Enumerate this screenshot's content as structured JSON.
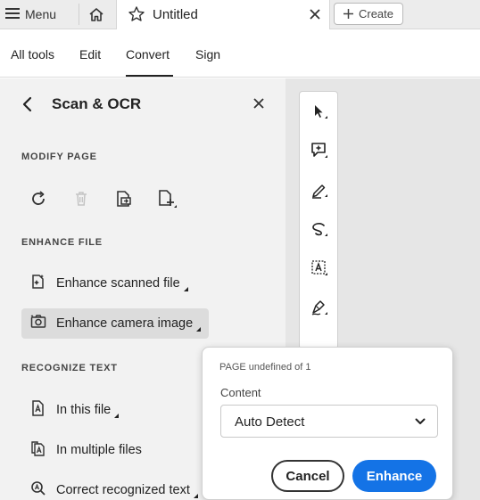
{
  "tabbar": {
    "menu_label": "Menu",
    "tab_title": "Untitled",
    "create_label": "Create"
  },
  "nav": {
    "items": [
      "All tools",
      "Edit",
      "Convert",
      "Sign"
    ],
    "active": "Convert"
  },
  "panel": {
    "title": "Scan & OCR",
    "modify_label": "MODIFY PAGE",
    "modify_tools": [
      "rotate-icon",
      "delete-icon",
      "extract-page-icon",
      "insert-page-icon"
    ],
    "enhance_label": "ENHANCE FILE",
    "enhance_items": [
      "Enhance scanned file",
      "Enhance camera image"
    ],
    "recognize_label": "RECOGNIZE TEXT",
    "recognize_items": [
      "In this file",
      "In multiple files",
      "Correct recognized text"
    ]
  },
  "toolrail": {
    "icons": [
      "select-arrow-icon",
      "add-comment-icon",
      "highlight-pen-icon",
      "freehand-draw-icon",
      "text-recognition-icon",
      "sign-icon"
    ]
  },
  "popover": {
    "page_text": "PAGE undefined of 1",
    "content_label": "Content",
    "content_value": "Auto Detect",
    "cancel_label": "Cancel",
    "enhance_label": "Enhance"
  },
  "colors": {
    "accent": "#1473e6",
    "panel_bg": "#f2f2f2",
    "doc_bg": "#e6e6e6"
  }
}
